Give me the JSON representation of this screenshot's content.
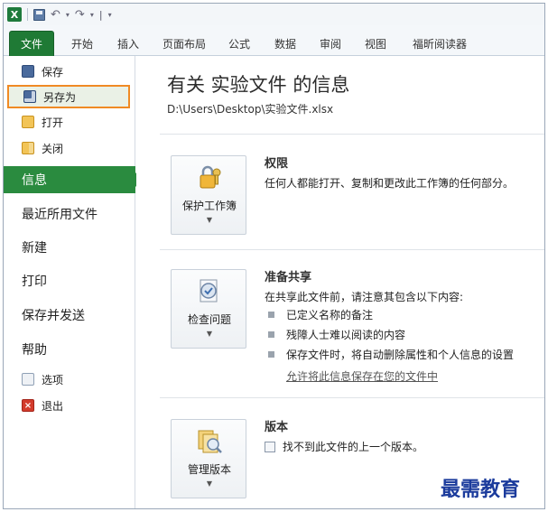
{
  "qat": {
    "app_logo": "X",
    "separator": "|",
    "undo_icon": "↶",
    "redo_icon": "↷",
    "customize_icon": "▾"
  },
  "ribbon": {
    "tabs": [
      {
        "label": "文件"
      },
      {
        "label": "开始"
      },
      {
        "label": "插入"
      },
      {
        "label": "页面布局"
      },
      {
        "label": "公式"
      },
      {
        "label": "数据"
      },
      {
        "label": "审阅"
      },
      {
        "label": "视图"
      },
      {
        "label": "福昕阅读器"
      }
    ]
  },
  "nav": {
    "save": "保存",
    "save_as": "另存为",
    "open": "打开",
    "close": "关闭",
    "info": "信息",
    "recent": "最近所用文件",
    "new": "新建",
    "print": "打印",
    "save_send": "保存并发送",
    "help": "帮助",
    "options": "选项",
    "exit": "退出",
    "exit_icon_glyph": "×"
  },
  "content": {
    "title": "有关 实验文件 的信息",
    "path": "D:\\Users\\Desktop\\实验文件.xlsx",
    "permissions": {
      "button_label": "保护工作簿",
      "heading": "权限",
      "text": "任何人都能打开、复制和更改此工作簿的任何部分。"
    },
    "prepare": {
      "button_label": "检查问题",
      "heading": "准备共享",
      "text": "在共享此文件前，请注意其包含以下内容:",
      "bullets": [
        "已定义名称的备注",
        "残障人士难以阅读的内容",
        "保存文件时，将自动删除属性和个人信息的设置"
      ],
      "link": "允许将此信息保存在您的文件中"
    },
    "versions": {
      "button_label": "管理版本",
      "heading": "版本",
      "text": "找不到此文件的上一个版本。"
    },
    "dropdown_glyph": "▼"
  },
  "watermark": "最需教育",
  "colors": {
    "file_tab": "#1f7a35",
    "info_selected": "#2a8b3f",
    "save_as_highlight": "#f08a24",
    "watermark": "#1b3b9c"
  }
}
